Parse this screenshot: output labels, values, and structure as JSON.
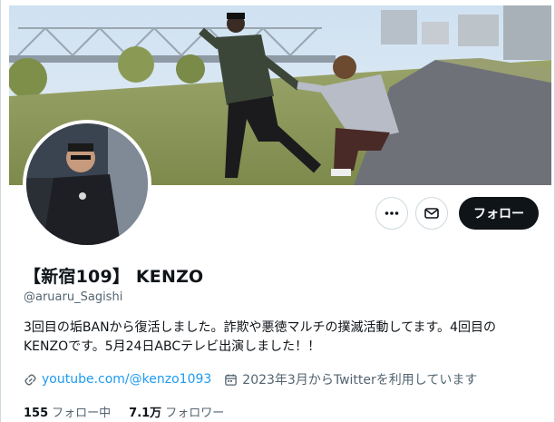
{
  "profile": {
    "name": "【新宿109】 KENZO",
    "handle": "@aruaru_Sagishi",
    "bio_line1": "3回目の垢BANから復活しました。詐欺や悪徳マルチの撲滅活動してます。4回目の",
    "bio_line2": "KENZOです。5月24日ABCテレビ出演しました！！",
    "website": "youtube.com/@kenzo1093",
    "joined": "2023年3月からTwitterを利用しています",
    "following_count": "155",
    "following_label": "フォロー中",
    "followers_count": "7.1万",
    "followers_label": "フォロワー"
  },
  "actions": {
    "follow_label": "フォロー",
    "more_icon": "more-icon",
    "message_icon": "mail-icon"
  },
  "colors": {
    "accent": "#1d9bf0",
    "text": "#0f1419",
    "muted": "#536471",
    "follow_bg": "#0f1419"
  }
}
